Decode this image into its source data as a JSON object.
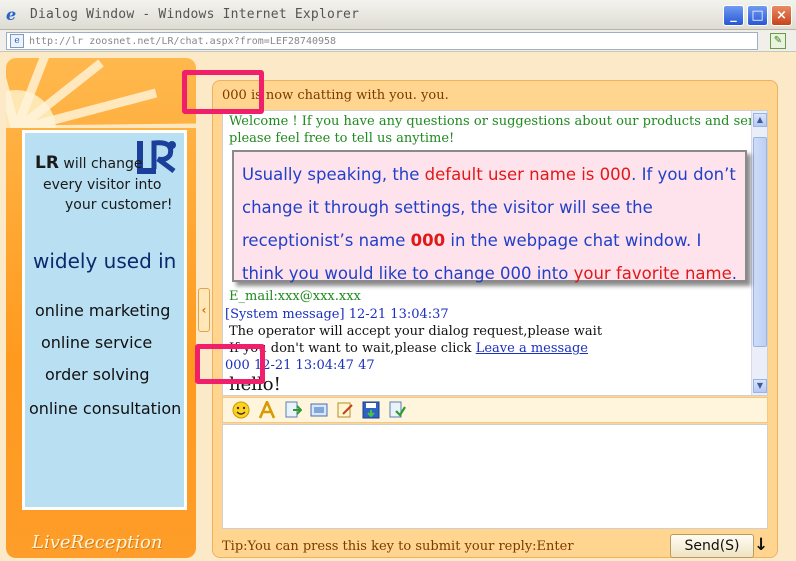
{
  "window": {
    "title": "Dialog Window - Windows Internet Explorer",
    "controls": [
      "_",
      "□",
      "×"
    ]
  },
  "address": {
    "url": "http://lr zoosnet.net/LR/chat.aspx?from=LEF28740958"
  },
  "sidebar": {
    "logo_text": "LR",
    "ad_will_change": "will change",
    "ad_line2": "every visitor into",
    "ad_line3": "your customer!",
    "ad_heading": "widely used in",
    "ad_items": [
      "online marketing",
      "online service",
      "order solving",
      "online consultation"
    ],
    "brand": "LiveReception"
  },
  "chat": {
    "header": "000 is now chatting with you.  you.",
    "messages": {
      "welcome_1": "Welcome ! If you have any questions or suggestions about our products and services,",
      "welcome_2": "please feel free to tell us anytime!",
      "email": "E_mail:xxx@xxx.xxx",
      "system_label": "[System message] 12-21 13:04:37",
      "operator_accept": "The operator will accept your dialog request,please wait",
      "wait_prefix": "If you don't want to wait,please click",
      "leave_message_link": "Leave a message",
      "operator_line": "000 12-21 13:04:47  47",
      "hello": "hello!"
    }
  },
  "callout": {
    "part1": "Usually speaking, the ",
    "part2": "default user name is 000",
    "part3": ". If you don’t change it through settings, the visitor will see the receptionist’s name ",
    "part4": "000",
    "part5": " in the webpage chat window. I think you would like to change 000 into ",
    "part6": "your favorite name",
    "part7": "."
  },
  "footer": {
    "tip": "Tip:You can press this key to submit your reply:Enter",
    "send_label": "Send(S)",
    "send_arrow": "↓"
  },
  "colors": {
    "highlight": "#f01e6b",
    "panel_orange": "#ff9a1f",
    "chat_bg": "#ffd590",
    "callout_bg": "#ffe3ec"
  }
}
